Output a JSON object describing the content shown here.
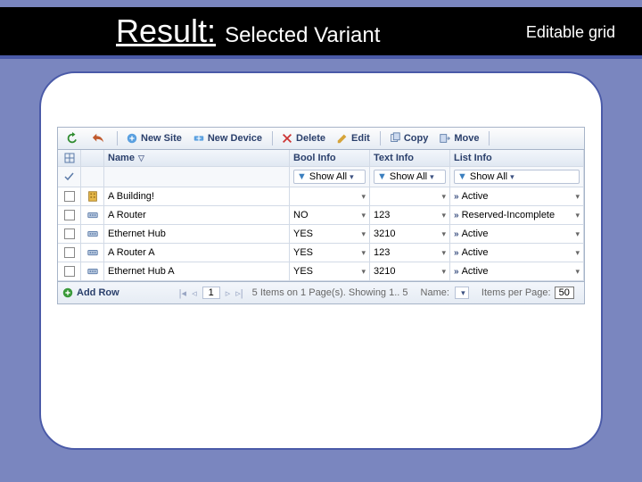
{
  "slide": {
    "title_main": "Result:",
    "title_sub": "Selected Variant",
    "title_right": "Editable grid"
  },
  "toolbar": {
    "new_site": "New Site",
    "new_device": "New Device",
    "delete": "Delete",
    "edit": "Edit",
    "copy": "Copy",
    "move": "Move"
  },
  "columns": {
    "name": "Name",
    "bool": "Bool Info",
    "text": "Text Info",
    "list": "List Info"
  },
  "filters": {
    "show_all": "Show All"
  },
  "rows": [
    {
      "icon": "building",
      "name": "A Building!",
      "bool": "",
      "text": "",
      "list": "Active"
    },
    {
      "icon": "device",
      "name": "A Router",
      "bool": "NO",
      "text": "123",
      "list": "Reserved-Incomplete"
    },
    {
      "icon": "device",
      "name": "Ethernet Hub",
      "bool": "YES",
      "text": "3210",
      "list": "Active"
    },
    {
      "icon": "device",
      "name": "A Router A",
      "bool": "YES",
      "text": "123",
      "list": "Active"
    },
    {
      "icon": "device",
      "name": "Ethernet Hub A",
      "bool": "YES",
      "text": "3210",
      "list": "Active"
    }
  ],
  "status": {
    "add_row": "Add Row",
    "page": "1",
    "summary": "5 Items on 1 Page(s). Showing 1.. 5",
    "name_label": "Name:",
    "ipp_label": "Items per Page:",
    "ipp_value": "50"
  }
}
